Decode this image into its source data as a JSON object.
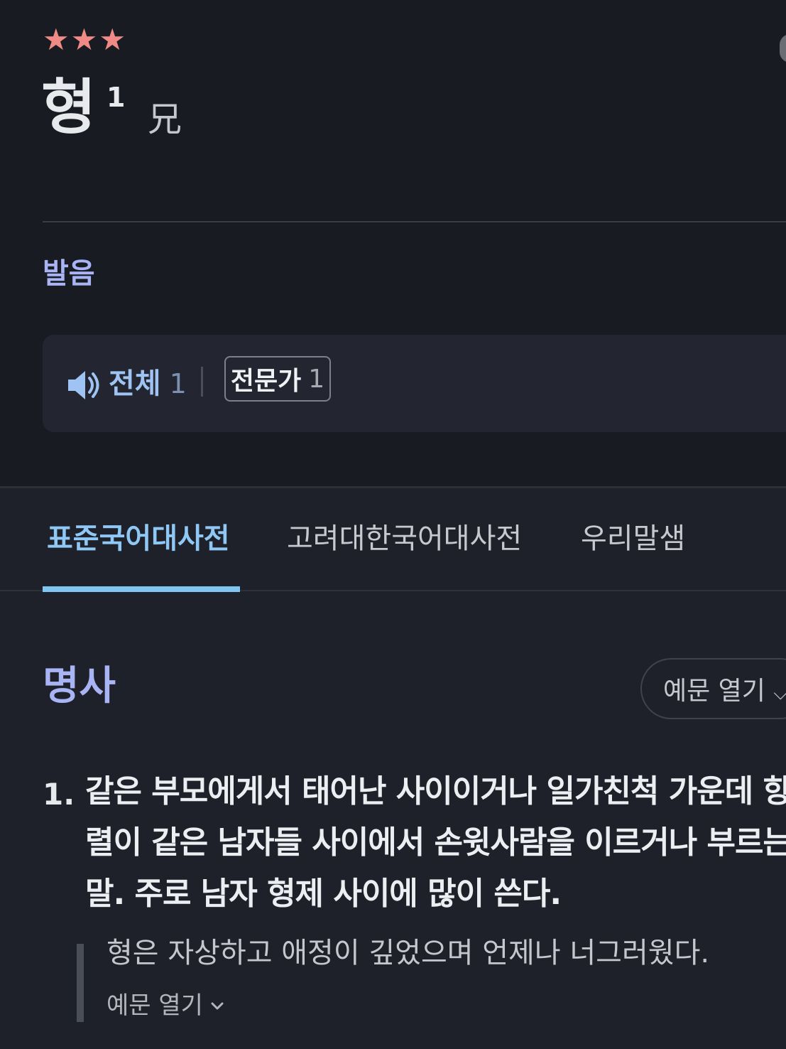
{
  "entry": {
    "stars": [
      "★",
      "★",
      "★"
    ],
    "headword": "형",
    "homonym_number": "1",
    "hanja": "兄"
  },
  "pronunciation": {
    "section_label": "발음",
    "all_label": "전체",
    "all_count": "1",
    "expert_label": "전문가",
    "expert_count": "1"
  },
  "tabs": [
    {
      "label": "표준국어대사전",
      "active": true
    },
    {
      "label": "고려대한국어대사전",
      "active": false
    },
    {
      "label": "우리말샘",
      "active": false
    }
  ],
  "definition": {
    "part_of_speech": "명사",
    "example_toggle_label": "예문 열기",
    "senses": [
      {
        "number": "1.",
        "text": "같은 부모에게서 태어난 사이이거나 일가친척 가운데 항렬이 같은 남자들 사이에서 손윗사람을 이르거나 부르는 말. 주로 남자 형제 사이에 많이 쓴다.",
        "example": "형은 자상하고 애정이 깊었으며 언제나 너그러웠다.",
        "example_more_label": "예문 열기"
      }
    ]
  },
  "colors": {
    "background": "#1e2129",
    "accent_blue": "#8fc8f5",
    "section_purple": "#a9b4f5",
    "star": "#f08a87"
  }
}
